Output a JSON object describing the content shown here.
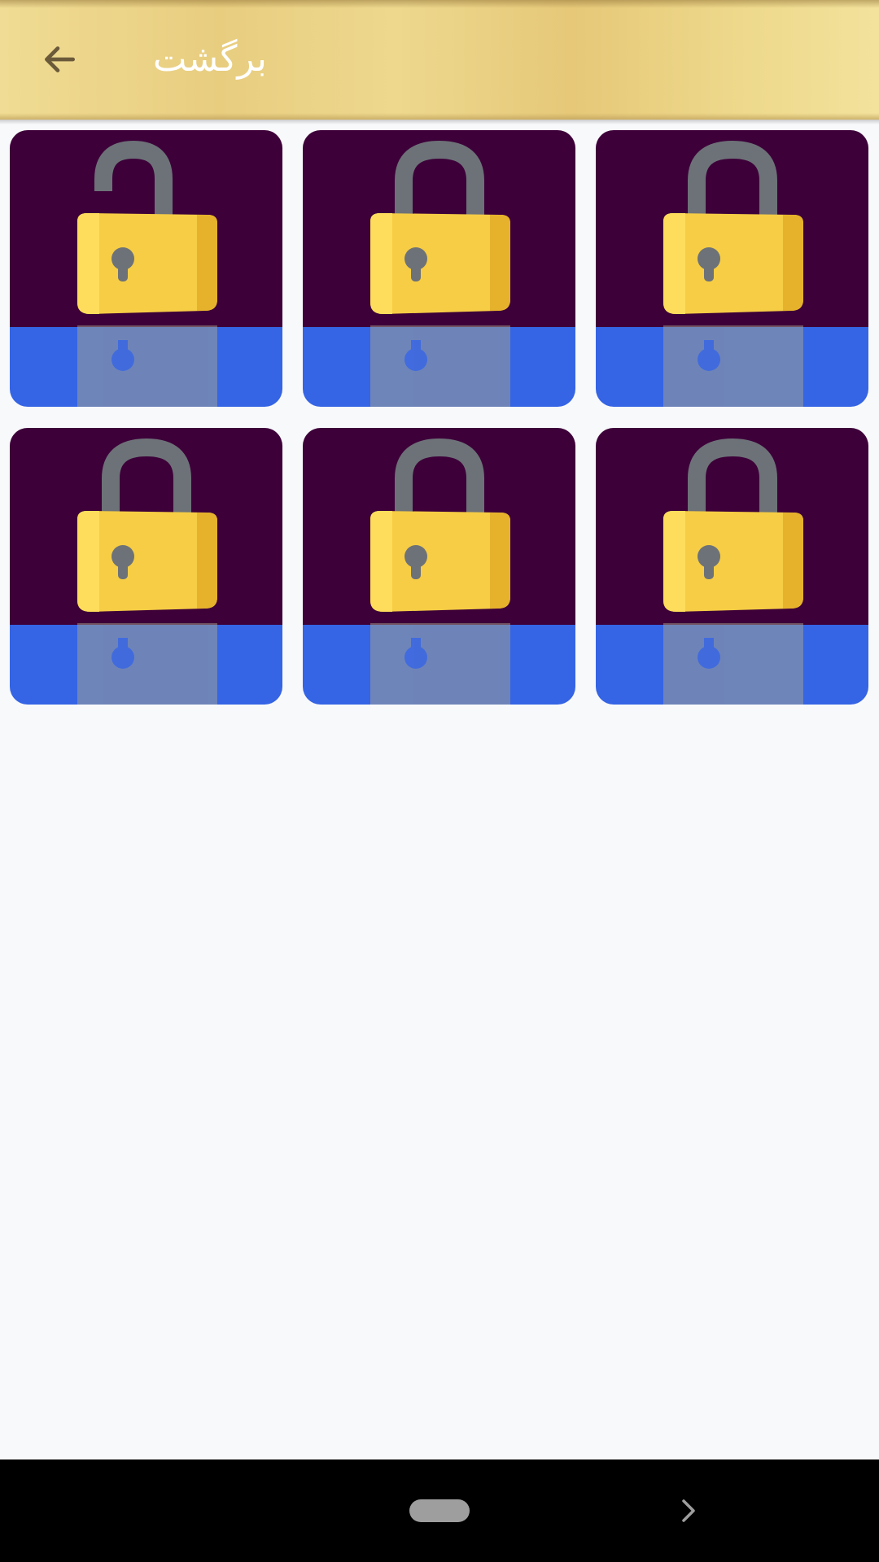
{
  "app_bar": {
    "title": "برگشت",
    "back_icon": "arrow-left-icon"
  },
  "grid": {
    "tiles": [
      {
        "icon": "lock-open-icon",
        "state": "unlocked"
      },
      {
        "icon": "lock-icon",
        "state": "locked"
      },
      {
        "icon": "lock-icon",
        "state": "locked"
      },
      {
        "icon": "lock-icon",
        "state": "locked"
      },
      {
        "icon": "lock-icon",
        "state": "locked"
      },
      {
        "icon": "lock-icon",
        "state": "locked"
      }
    ]
  },
  "colors": {
    "tile_background": "#3d0039",
    "tile_floor": "#3564e4",
    "lock_body": "#f6cd45",
    "lock_shackle": "#6d7278"
  },
  "system_nav": {
    "home": "home-pill",
    "forward": "chevron-right-icon"
  }
}
